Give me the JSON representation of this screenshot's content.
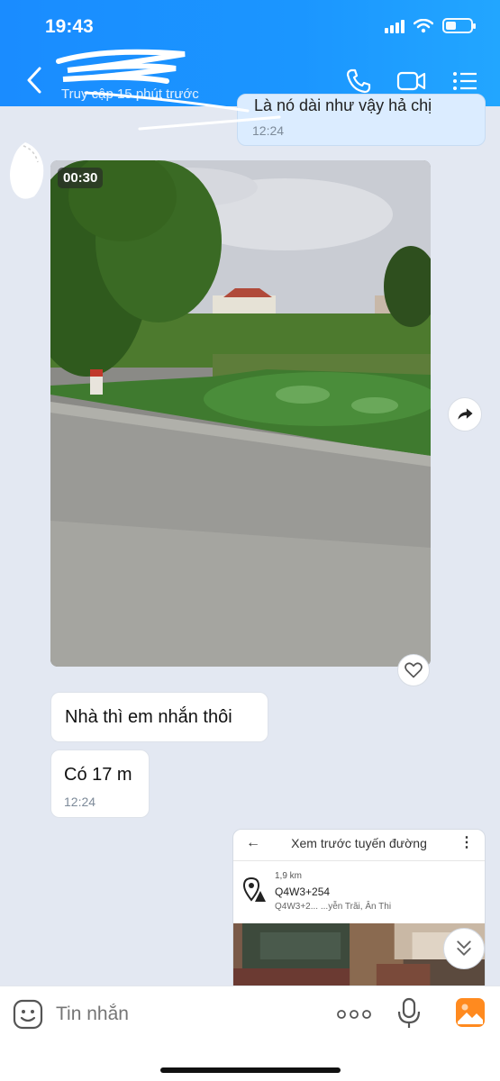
{
  "status": {
    "time": "19:43"
  },
  "header": {
    "contact_name": "",
    "last_seen": "Truy cập 15 phút trước"
  },
  "messages": {
    "outgoing_top": {
      "text": "Là nó dài như vậy hả chị",
      "time": "12:24"
    },
    "video": {
      "duration": "00:30"
    },
    "incoming_1": {
      "text": "Nhà thì em nhắn thôi"
    },
    "incoming_2": {
      "text": "Có 17 m",
      "time": "12:24"
    }
  },
  "map_card": {
    "title": "Xem trước tuyến đường",
    "distance": "1,9 km",
    "place_code": "Q4W3+254",
    "address": "Q4W3+2... ...yễn Trãi, Ân Thi"
  },
  "input_bar": {
    "placeholder": "Tin nhắn"
  },
  "colors": {
    "header": "#1a8cff",
    "background": "#e3e8f2",
    "outgoing_bubble": "#dbecff",
    "photo_icon": "#ff8a1f"
  },
  "icons": [
    "back-icon",
    "phone-icon",
    "video-call-icon",
    "list-menu-icon",
    "share-icon",
    "heart-icon",
    "chevron-double-down-icon",
    "sticker-icon",
    "more-dots-icon",
    "microphone-icon",
    "photo-icon"
  ]
}
